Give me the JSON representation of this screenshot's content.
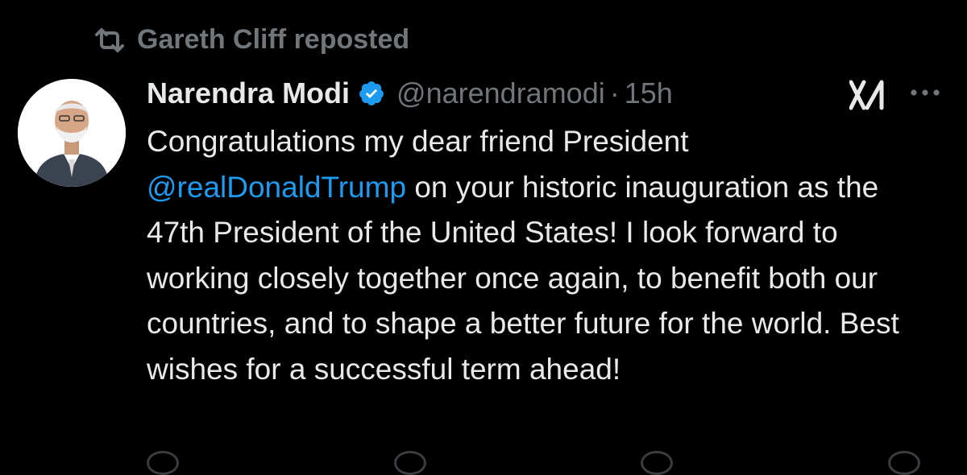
{
  "repost": {
    "text": "Gareth Cliff reposted",
    "icon": "repost-icon"
  },
  "tweet": {
    "author": {
      "name": "Narendra Modi",
      "handle": "@narendramodi",
      "verified": true,
      "verified_color": "#1d9bf0",
      "avatar": "avatar-photo"
    },
    "time_separator": "·",
    "time": "15h",
    "body": {
      "part1": "Congratulations my dear friend President ",
      "mention": "@realDonaldTrump",
      "part2": " on your historic inauguration as the 47th President of the United States! I look forward to working closely together once again, to benefit both our countries, and to shape a better future for the world. Best wishes for a successful term ahead!"
    },
    "grok_icon": "grok-icon",
    "more_icon": "more-options-icon"
  },
  "colors": {
    "background": "#000000",
    "text": "#e7e9ea",
    "muted": "#71767b",
    "link": "#1d9bf0"
  }
}
